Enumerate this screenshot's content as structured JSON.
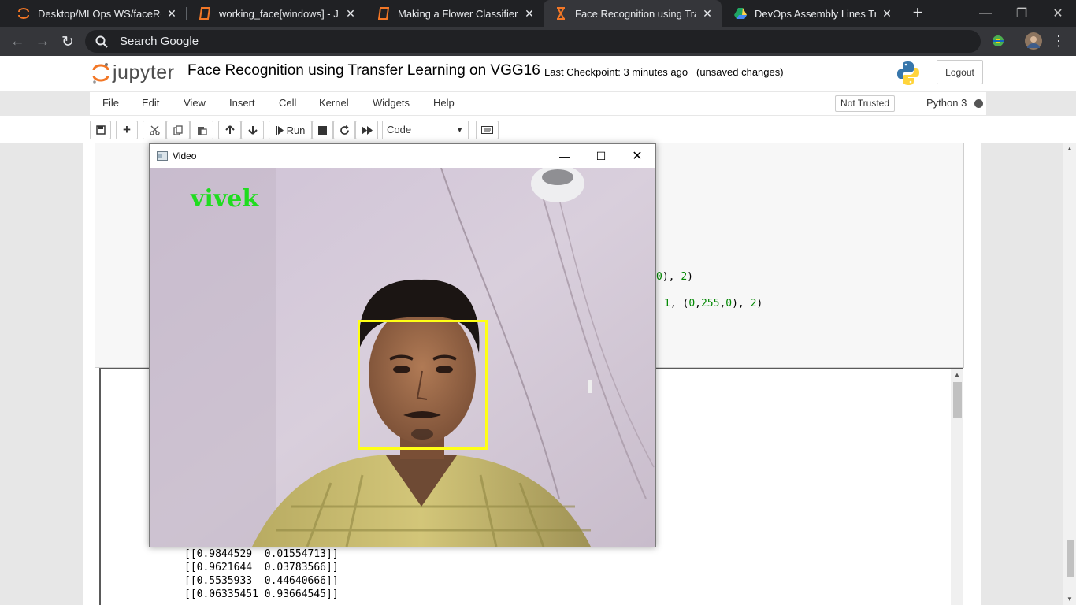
{
  "browser": {
    "tabs": [
      {
        "title": "Desktop/MLOps WS/faceRecog",
        "icon": "jupyter-icon"
      },
      {
        "title": "working_face[windows] - Jupyt",
        "icon": "notebook-icon"
      },
      {
        "title": "Making a Flower Classifier with",
        "icon": "notebook-icon"
      },
      {
        "title": "Face Recognition using Transfe",
        "icon": "hourglass-icon",
        "active": true
      },
      {
        "title": "DevOps Assembly Lines Trainin",
        "icon": "google-drive-icon"
      }
    ],
    "omnibox_text": "Search Google",
    "accent": "#202124"
  },
  "jupyter": {
    "logo_text": "jupyter",
    "notebook_title": "Face Recognition using Transfer Learning on VGG16",
    "checkpoint": "Last Checkpoint: 3 minutes ago",
    "unsaved": "(unsaved changes)",
    "logout_label": "Logout",
    "menu": [
      "File",
      "Edit",
      "View",
      "Insert",
      "Cell",
      "Kernel",
      "Widgets",
      "Help"
    ],
    "trust_label": "Not Trusted",
    "kernel_name": "Python 3",
    "run_label": "Run",
    "cell_type": "Code"
  },
  "code_lines": [
    {
      "pre": "0), 2)",
      "nums": []
    },
    {
      "pre": "1, (0,255,0), 2)",
      "nums": []
    }
  ],
  "output_lines": [
    "[[0.9844529  0.01554713]]",
    "[[0.9621644  0.03783566]]",
    "[[0.5535933  0.44640666]]",
    "[[0.06335451 0.93664545]]"
  ],
  "video": {
    "window_title": "Video",
    "detected_label": "vivek",
    "label_color": "#1fdc1f",
    "box_color": "#ffff14"
  }
}
